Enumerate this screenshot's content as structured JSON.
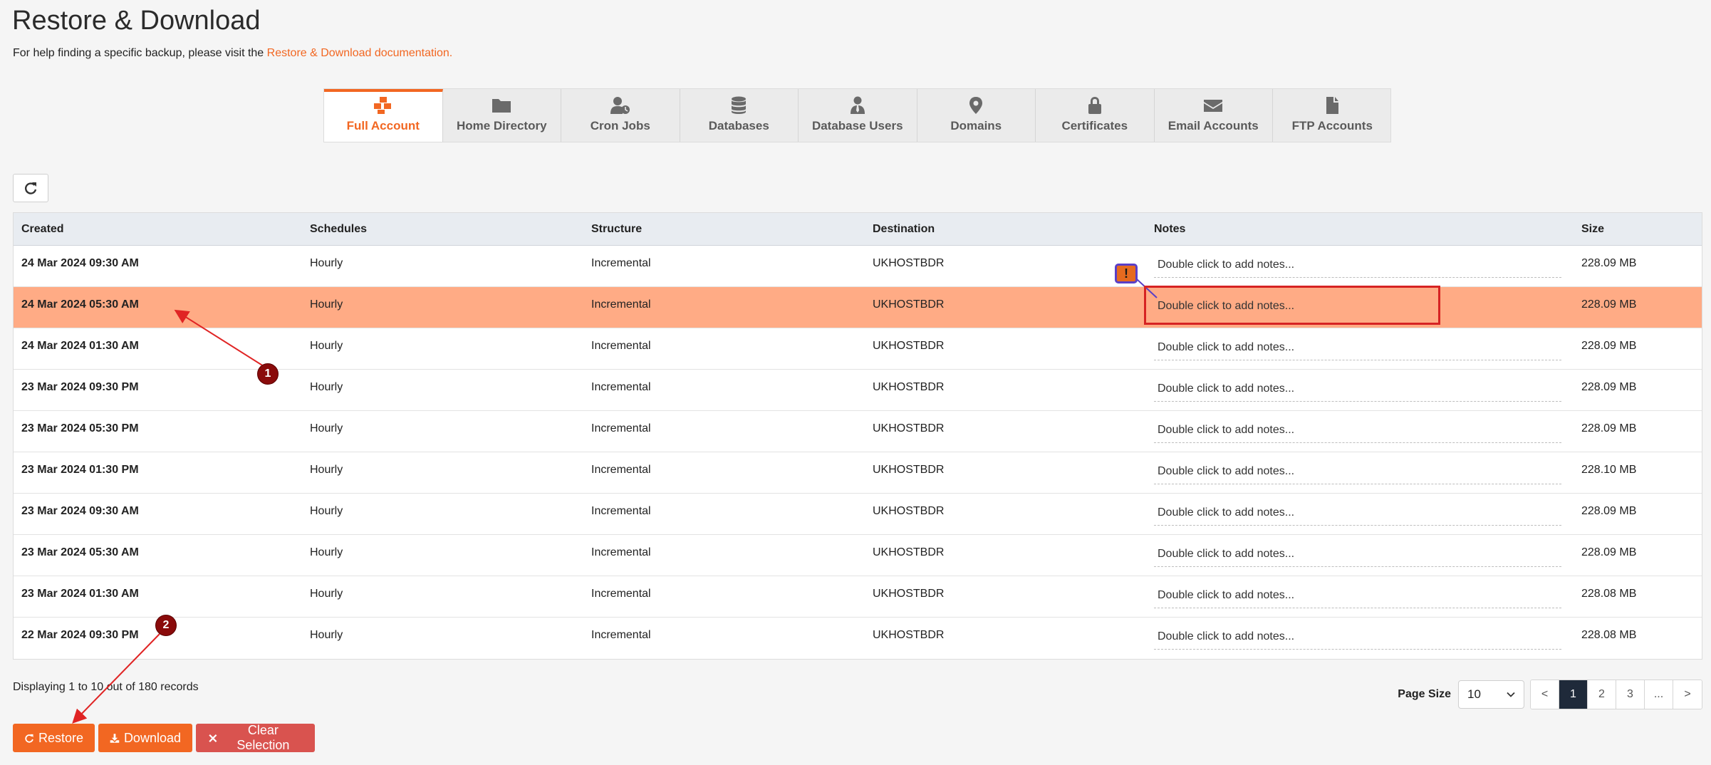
{
  "title": "Restore & Download",
  "help": {
    "text": "For help finding a specific backup, please visit the ",
    "link": "Restore & Download documentation."
  },
  "tabs": [
    {
      "label": "Full Account",
      "icon": "cubes-icon",
      "active": true
    },
    {
      "label": "Home Directory",
      "icon": "folder-icon"
    },
    {
      "label": "Cron Jobs",
      "icon": "user-clock-icon"
    },
    {
      "label": "Databases",
      "icon": "database-icon"
    },
    {
      "label": "Database Users",
      "icon": "user-tie-icon"
    },
    {
      "label": "Domains",
      "icon": "map-pin-icon"
    },
    {
      "label": "Certificates",
      "icon": "lock-icon"
    },
    {
      "label": "Email Accounts",
      "icon": "envelope-icon"
    },
    {
      "label": "FTP Accounts",
      "icon": "file-icon"
    }
  ],
  "table": {
    "headers": {
      "created": "Created",
      "schedules": "Schedules",
      "structure": "Structure",
      "destination": "Destination",
      "notes": "Notes",
      "size": "Size"
    },
    "rows": [
      {
        "created": "24 Mar 2024 09:30 AM",
        "schedule": "Hourly",
        "structure": "Incremental",
        "destination": "UKHOSTBDR",
        "notes": "Double click to add notes...",
        "size": "228.09 MB"
      },
      {
        "created": "24 Mar 2024 05:30 AM",
        "schedule": "Hourly",
        "structure": "Incremental",
        "destination": "UKHOSTBDR",
        "notes": "Double click to add notes...",
        "size": "228.09 MB",
        "selected": true
      },
      {
        "created": "24 Mar 2024 01:30 AM",
        "schedule": "Hourly",
        "structure": "Incremental",
        "destination": "UKHOSTBDR",
        "notes": "Double click to add notes...",
        "size": "228.09 MB"
      },
      {
        "created": "23 Mar 2024 09:30 PM",
        "schedule": "Hourly",
        "structure": "Incremental",
        "destination": "UKHOSTBDR",
        "notes": "Double click to add notes...",
        "size": "228.09 MB"
      },
      {
        "created": "23 Mar 2024 05:30 PM",
        "schedule": "Hourly",
        "structure": "Incremental",
        "destination": "UKHOSTBDR",
        "notes": "Double click to add notes...",
        "size": "228.09 MB"
      },
      {
        "created": "23 Mar 2024 01:30 PM",
        "schedule": "Hourly",
        "structure": "Incremental",
        "destination": "UKHOSTBDR",
        "notes": "Double click to add notes...",
        "size": "228.10 MB"
      },
      {
        "created": "23 Mar 2024 09:30 AM",
        "schedule": "Hourly",
        "structure": "Incremental",
        "destination": "UKHOSTBDR",
        "notes": "Double click to add notes...",
        "size": "228.09 MB"
      },
      {
        "created": "23 Mar 2024 05:30 AM",
        "schedule": "Hourly",
        "structure": "Incremental",
        "destination": "UKHOSTBDR",
        "notes": "Double click to add notes...",
        "size": "228.09 MB"
      },
      {
        "created": "23 Mar 2024 01:30 AM",
        "schedule": "Hourly",
        "structure": "Incremental",
        "destination": "UKHOSTBDR",
        "notes": "Double click to add notes...",
        "size": "228.08 MB"
      },
      {
        "created": "22 Mar 2024 09:30 PM",
        "schedule": "Hourly",
        "structure": "Incremental",
        "destination": "UKHOSTBDR",
        "notes": "Double click to add notes...",
        "size": "228.08 MB"
      }
    ]
  },
  "records_text": "Displaying 1 to 10 out of 180 records",
  "actions": {
    "restore": "Restore",
    "download": "Download",
    "clear": "Clear Selection"
  },
  "pager": {
    "page_size_label": "Page Size",
    "page_size": "10",
    "prev": "<",
    "next": ">",
    "pages": [
      "1",
      "2",
      "3",
      "..."
    ],
    "current": "1"
  },
  "annotations": {
    "badge1": "1",
    "badge2": "2",
    "warn": "!"
  },
  "colors": {
    "accent": "#f26722",
    "selected_row": "#ffab85",
    "danger": "#d9534f",
    "annotation_red": "#d62323"
  }
}
